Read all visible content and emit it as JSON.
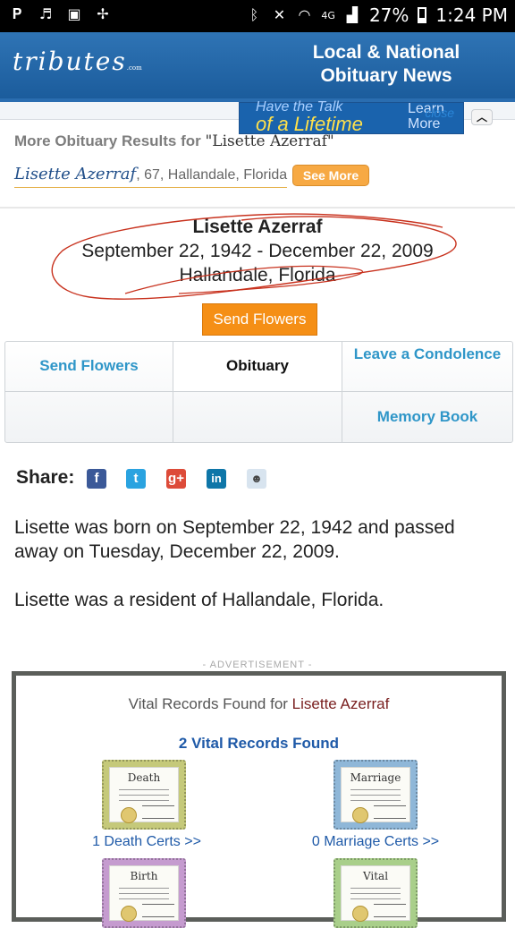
{
  "status_bar": {
    "battery": "27%",
    "time": "1:24 PM",
    "network": "4G"
  },
  "header": {
    "logo": "tributes",
    "logo_suffix": ".com",
    "title_line1": "Local & National",
    "title_line2": "Obituary News"
  },
  "ad_banner": {
    "line1": "Have the Talk",
    "line2": "of a Lifetime",
    "learn_more": "Learn More",
    "close": "close"
  },
  "more_results": {
    "heading": "More Obituary Results for ",
    "query": "\"Lisette Azerraf\"",
    "result_name": "Lisette Azerraf",
    "result_details": ", 67, Hallandale, Florida",
    "see_more": "See More"
  },
  "obituary": {
    "name": "Lisette Azerraf",
    "dates": "September 22, 1942 - December 22, 2009",
    "location": "Hallandale, Florida",
    "send_flowers": "Send Flowers"
  },
  "tabs": {
    "send_flowers": "Send Flowers",
    "obituary": "Obituary",
    "leave_condolence": "Leave a Condolence",
    "memory_book": "Memory Book"
  },
  "share": {
    "label": "Share:"
  },
  "body": {
    "para1": "Lisette was born on September 22, 1942 and passed away on Tuesday, December 22, 2009.",
    "para2": "Lisette was a resident of Hallandale, Florida."
  },
  "advertisement": {
    "label": "- ADVERTISEMENT -",
    "title_prefix": "Vital Records Found for ",
    "title_name": "Lisette Azerraf",
    "count": "2 Vital Records Found",
    "certs": [
      {
        "title": "Death",
        "link": "1 Death Certs >>",
        "color": "#c5c97a"
      },
      {
        "title": "Marriage",
        "link": "0 Marriage Certs >>",
        "color": "#8fb7d8"
      },
      {
        "title": "Birth",
        "link": "",
        "color": "#c59bcf"
      },
      {
        "title": "Vital",
        "link": "",
        "color": "#a9cf8a"
      }
    ]
  },
  "colors": {
    "header_blue": "#1b5c9c",
    "accent_orange": "#f58f16",
    "tab_link": "#2f96c8",
    "annotation_red": "#c8321e"
  }
}
